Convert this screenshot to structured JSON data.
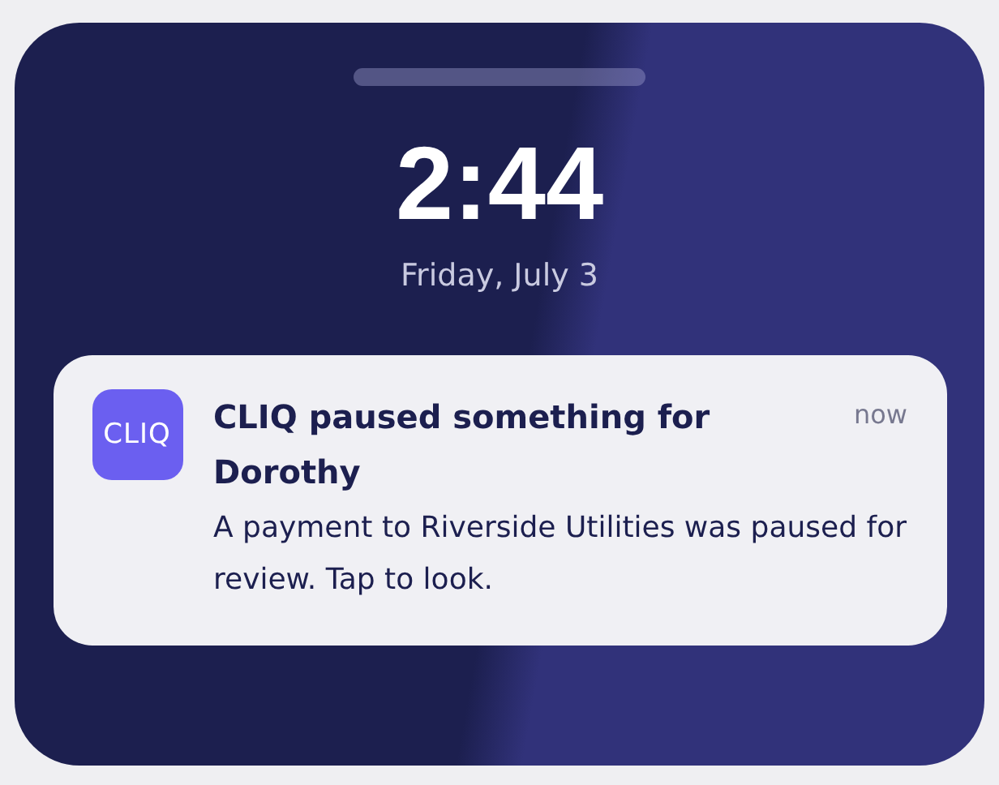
{
  "lock_screen": {
    "time": "2:44",
    "date": "Friday, July 3"
  },
  "notification": {
    "app_icon": "CLIQ",
    "title": "CLIQ paused something for Dorothy",
    "time": "now",
    "body": "A payment to Riverside Utilities was paused for review. Tap to look."
  }
}
